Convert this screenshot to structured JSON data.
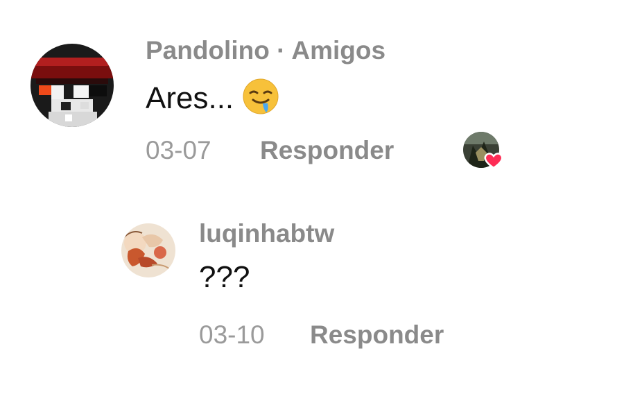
{
  "comments": [
    {
      "author": "Pandolino",
      "separator": " · ",
      "relation": "Amigos",
      "text": "Ares...",
      "emoji": "drooling-face-icon",
      "date": "03-07",
      "reply_label": "Responder",
      "liked_by_creator": true
    },
    {
      "author": "luqinhabtw",
      "text": "???",
      "date": "03-10",
      "reply_label": "Responder"
    }
  ],
  "colors": {
    "muted": "#8a8a8a",
    "date": "#9a9a9a",
    "text": "#111111",
    "heart": "#fe2c55"
  }
}
